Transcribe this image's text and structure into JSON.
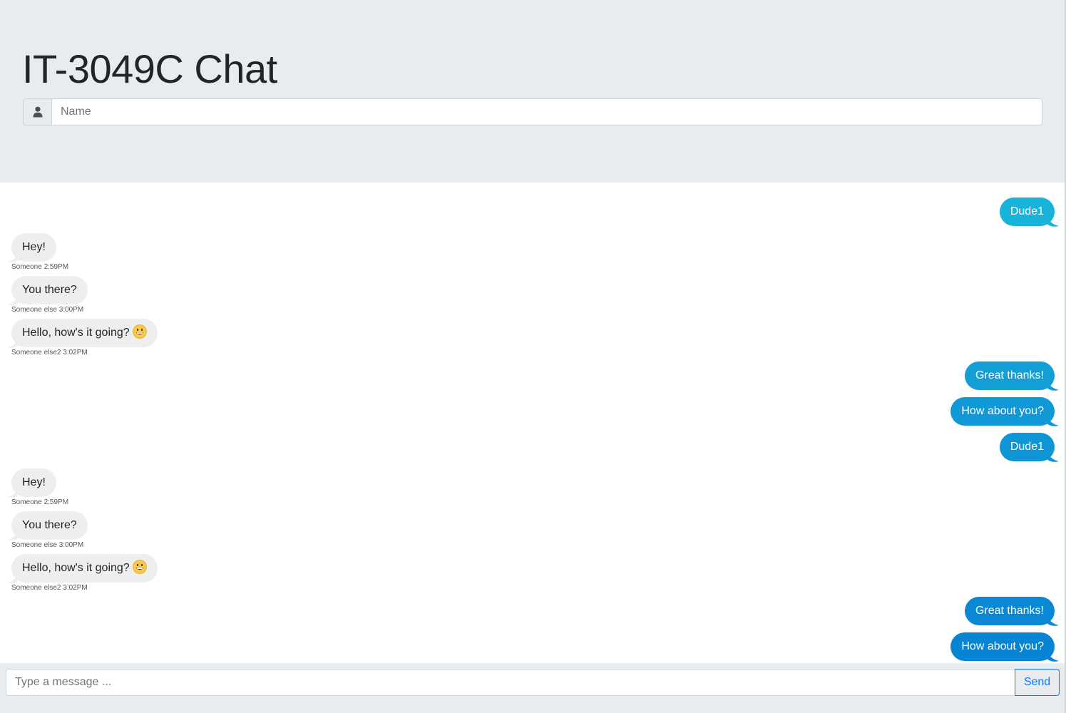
{
  "header": {
    "title": "IT-3049C Chat",
    "name_placeholder": "Name",
    "name_value": "",
    "user_icon": "user-icon"
  },
  "messages": [
    {
      "side": "right",
      "text": "Dude1",
      "color": "#17b3d9",
      "emoji": false
    },
    {
      "side": "left",
      "text": "Hey!",
      "meta": "Someone 2:59PM",
      "emoji": false
    },
    {
      "side": "left",
      "text": "You there?",
      "meta": "Someone else 3:00PM",
      "emoji": false
    },
    {
      "side": "left",
      "text": "Hello, how's it going?",
      "meta": "Someone else2 3:02PM",
      "emoji": true
    },
    {
      "side": "right",
      "text": "Great thanks!",
      "color": "#139fd6",
      "emoji": false
    },
    {
      "side": "right",
      "text": "How about you?",
      "color": "#1198d6",
      "emoji": false
    },
    {
      "side": "right",
      "text": "Dude1",
      "color": "#0e95d6",
      "emoji": false
    },
    {
      "side": "left",
      "text": "Hey!",
      "meta": "Someone 2:59PM",
      "emoji": false
    },
    {
      "side": "left",
      "text": "You there?",
      "meta": "Someone else 3:00PM",
      "emoji": false
    },
    {
      "side": "left",
      "text": "Hello, how's it going?",
      "meta": "Someone else2 3:02PM",
      "emoji": true
    },
    {
      "side": "right",
      "text": "Great thanks!",
      "color": "#0a88d4",
      "emoji": false
    },
    {
      "side": "right",
      "text": "How about you?",
      "color": "#0784d3",
      "emoji": false
    }
  ],
  "composer": {
    "placeholder": "Type a message ...",
    "value": "",
    "send_label": "Send"
  },
  "colors": {
    "header_bg": "#e9ecef",
    "incoming_bubble": "#eeeeee",
    "send_accent": "#007bff"
  }
}
